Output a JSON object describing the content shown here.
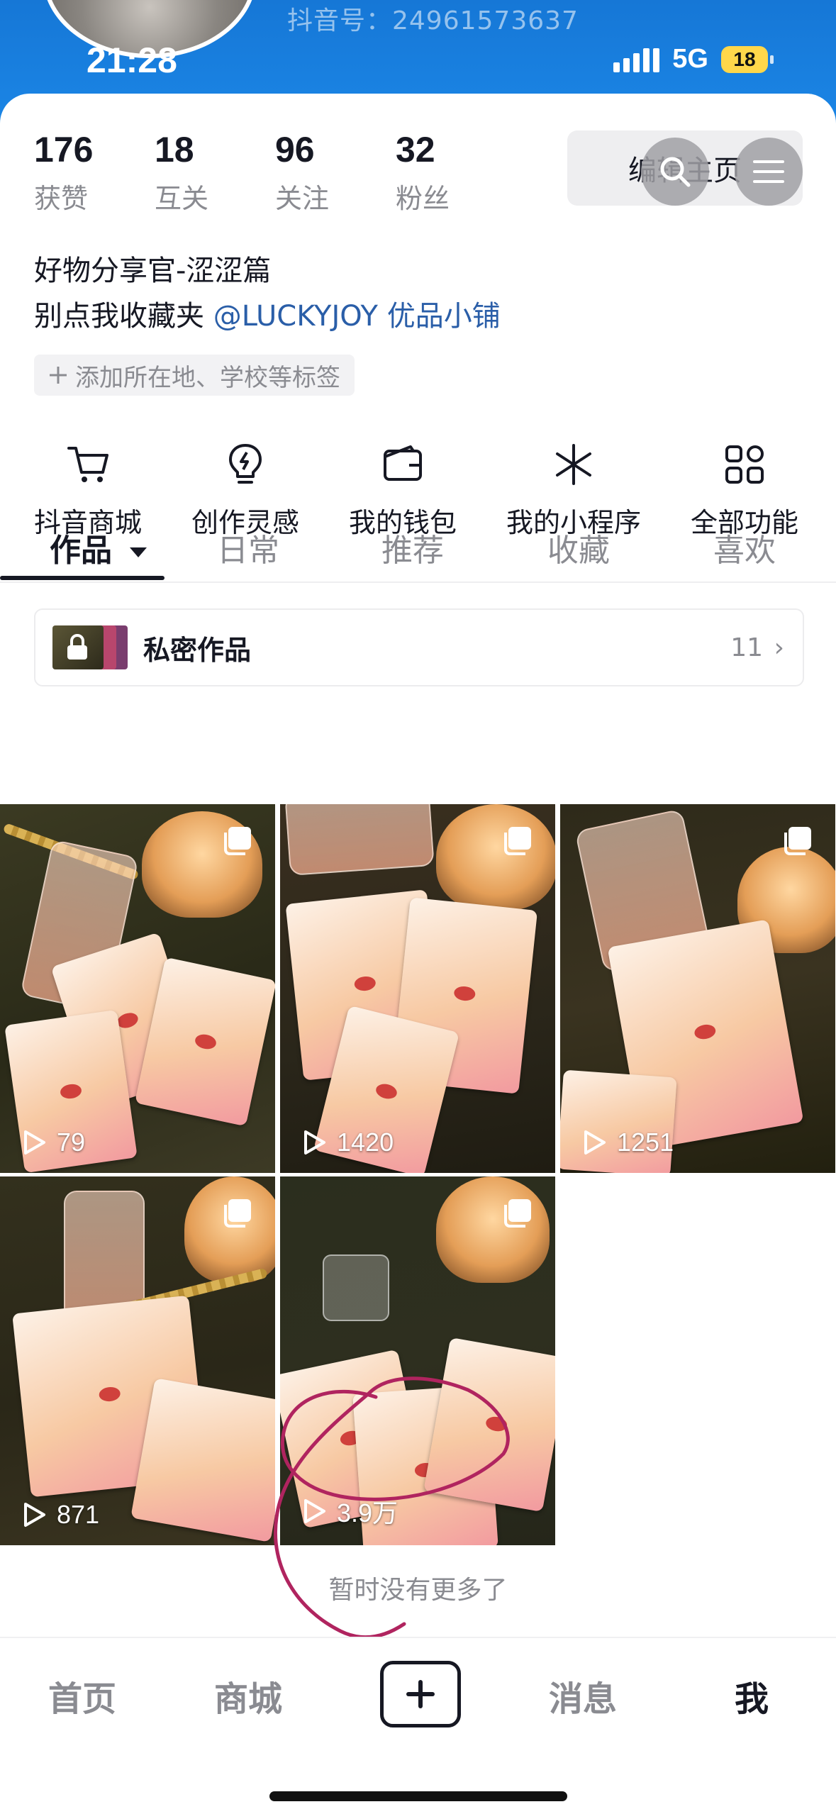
{
  "status_bar": {
    "time": "21:28",
    "network": "5G",
    "battery": "18"
  },
  "profile": {
    "douyin_id": "抖音号：24961573637",
    "stats": [
      {
        "num": "176",
        "label": "获赞"
      },
      {
        "num": "18",
        "label": "互关"
      },
      {
        "num": "96",
        "label": "关注"
      },
      {
        "num": "32",
        "label": "粉丝"
      }
    ],
    "edit_label": "编辑主页",
    "bio_line1": "好物分享官-涩涩篇",
    "bio_line2_prefix": "别点我收藏夹 ",
    "bio_mention": "@LUCKYJOY 优品小铺",
    "tag_chip": "添加所在地、学校等标签"
  },
  "quick_actions": [
    {
      "label": "抖音商城",
      "icon": "cart-icon"
    },
    {
      "label": "创作灵感",
      "icon": "lightbulb-icon"
    },
    {
      "label": "我的钱包",
      "icon": "wallet-icon"
    },
    {
      "label": "我的小程序",
      "icon": "asterisk-icon"
    },
    {
      "label": "全部功能",
      "icon": "grid-icon"
    }
  ],
  "tabs": [
    "作品",
    "日常",
    "推荐",
    "收藏",
    "喜欢"
  ],
  "private_works": {
    "label": "私密作品",
    "count": "11"
  },
  "videos": [
    {
      "plays": "79"
    },
    {
      "plays": "1420"
    },
    {
      "plays": "1251"
    },
    {
      "plays": "871"
    },
    {
      "plays": "3.9万"
    }
  ],
  "empty_note": "暂时没有更多了",
  "bottom_nav": {
    "home": "首页",
    "mall": "商城",
    "messages": "消息",
    "me": "我"
  },
  "colors": {
    "accent_blue": "#1b86e6",
    "mention": "#2a5ea8",
    "scribble": "#b0245f"
  }
}
